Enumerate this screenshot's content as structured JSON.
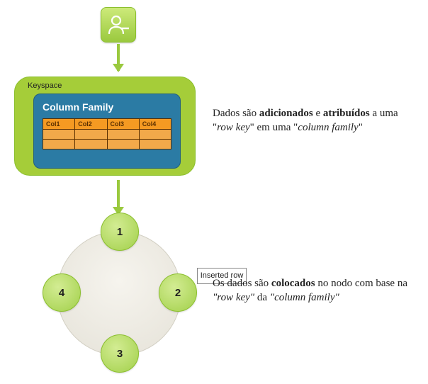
{
  "colors": {
    "green": "#9ac93e",
    "blue": "#2b7ba4",
    "orange": "#f59a22"
  },
  "keyspace": {
    "label": "Keyspace",
    "column_family": {
      "title": "Column Family",
      "cols": [
        "Col1",
        "Col2",
        "Col3",
        "Col4"
      ]
    }
  },
  "captions": {
    "c1": {
      "pre": "Dados são ",
      "b1": "adicionados",
      "mid": " e ",
      "b2": "atribuídos",
      "post": " a uma \"",
      "i1": "row key",
      "post2": "\" em uma \"",
      "i2": "column family",
      "post3": "\""
    },
    "c2": {
      "pre": "Os dados são ",
      "b1": "colocados",
      "post": " no nodo com base na ",
      "i1": "\"row key\"",
      "mid2": " da ",
      "i2": "\"column family\""
    }
  },
  "ring": {
    "nodes": [
      "1",
      "2",
      "3",
      "4"
    ],
    "inserted_label": "Inserted row"
  }
}
